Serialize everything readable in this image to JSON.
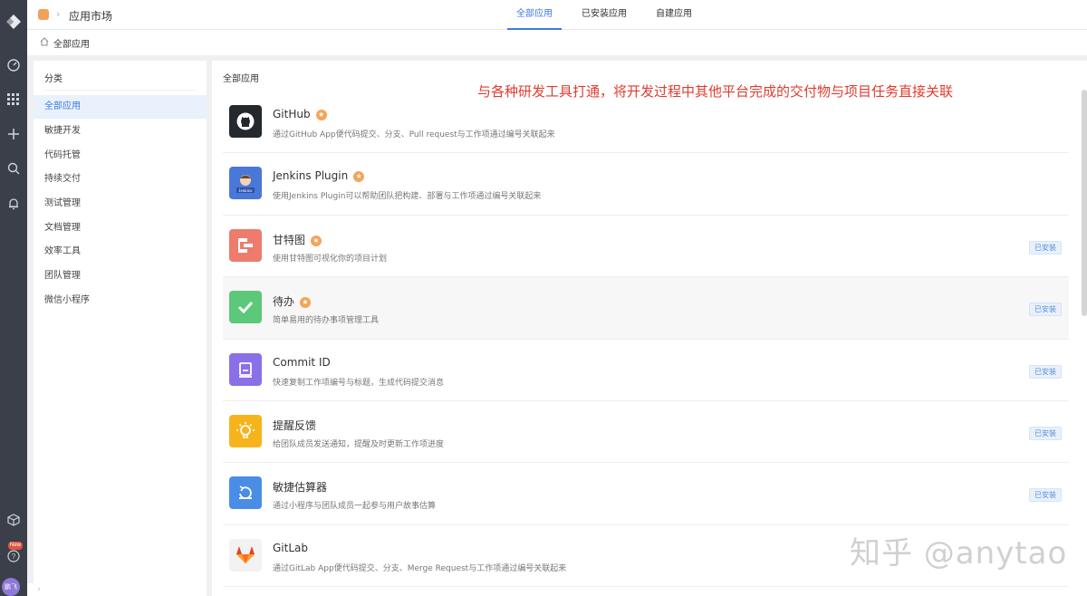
{
  "header": {
    "title": "应用市场",
    "tabs": [
      {
        "label": "全部应用",
        "active": true
      },
      {
        "label": "已安装应用",
        "active": false
      },
      {
        "label": "自建应用",
        "active": false
      }
    ]
  },
  "breadcrumb": {
    "current": "全部应用"
  },
  "rail": {
    "new_badge": "New",
    "avatar_text": "鹏飞"
  },
  "sidebar": {
    "title": "分类",
    "items": [
      {
        "label": "全部应用",
        "active": true
      },
      {
        "label": "敏捷开发",
        "active": false
      },
      {
        "label": "代码托管",
        "active": false
      },
      {
        "label": "持续交付",
        "active": false
      },
      {
        "label": "测试管理",
        "active": false
      },
      {
        "label": "文档管理",
        "active": false
      },
      {
        "label": "效率工具",
        "active": false
      },
      {
        "label": "团队管理",
        "active": false
      },
      {
        "label": "微信小程序",
        "active": false
      }
    ]
  },
  "main": {
    "title": "全部应用",
    "annotation": "与各种研发工具打通，将开发过程中其他平台完成的交付物与项目任务直接关联",
    "apps": [
      {
        "name": "GitHub",
        "desc": "通过GitHub App便代码提交、分支、Pull request与工作项通过编号关联起来",
        "starred": true,
        "installed": false,
        "icon": "github-icon",
        "icon_bg": "#24292e"
      },
      {
        "name": "Jenkins Plugin",
        "desc": "使用Jenkins Plugin可以帮助团队把构建、部署与工作项通过编号关联起来",
        "starred": true,
        "installed": false,
        "icon": "jenkins-icon",
        "icon_bg": "#4a78d8"
      },
      {
        "name": "甘特图",
        "desc": "使用甘特图可视化你的项目计划",
        "starred": true,
        "installed": true,
        "icon": "gantt-icon",
        "icon_bg": "#ee7b6c"
      },
      {
        "name": "待办",
        "desc": "简单易用的待办事项管理工具",
        "starred": true,
        "installed": true,
        "icon": "todo-check-icon",
        "icon_bg": "#5cc87a"
      },
      {
        "name": "Commit ID",
        "desc": "快速复制工作项编号与标题，生成代码提交消息",
        "starred": false,
        "installed": true,
        "icon": "commit-id-icon",
        "icon_bg": "#8a6fe8"
      },
      {
        "name": "提醒反馈",
        "desc": "给团队成员发送通知，提醒及时更新工作项进度",
        "starred": false,
        "installed": true,
        "icon": "lightbulb-icon",
        "icon_bg": "#f6b41c"
      },
      {
        "name": "敏捷估算器",
        "desc": "通过小程序与团队成员一起参与用户故事估算",
        "starred": false,
        "installed": true,
        "icon": "estimator-icon",
        "icon_bg": "#4a8de6"
      },
      {
        "name": "GitLab",
        "desc": "通过GitLab App便代码提交、分支、Merge Request与工作项通过编号关联起来",
        "starred": false,
        "installed": false,
        "icon": "gitlab-icon",
        "icon_bg": "#f2f2f2"
      }
    ],
    "installed_label": "已安装",
    "star_glyph": "★"
  },
  "watermark": "知乎 @anytao"
}
